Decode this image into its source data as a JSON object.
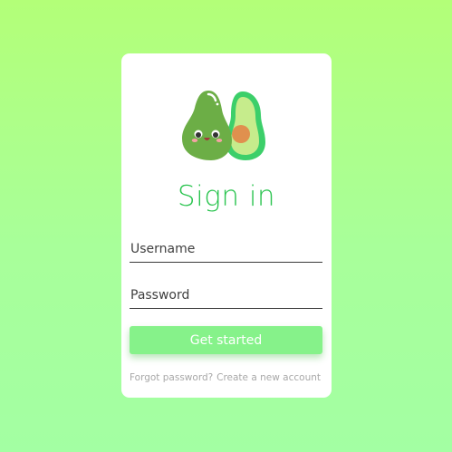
{
  "login": {
    "title": "Sign in",
    "username_placeholder": "Username",
    "password_placeholder": "Password",
    "submit_label": "Get started",
    "forgot_password_label": "Forgot password?",
    "create_account_label": "Create a new account"
  },
  "logo": {
    "icon": "avocado-icon"
  },
  "colors": {
    "background_top": "#b3ff78",
    "background_bottom": "#a3ffa3",
    "title": "#2ac44f",
    "button": "#86f28a",
    "link": "#a8a8a8"
  }
}
